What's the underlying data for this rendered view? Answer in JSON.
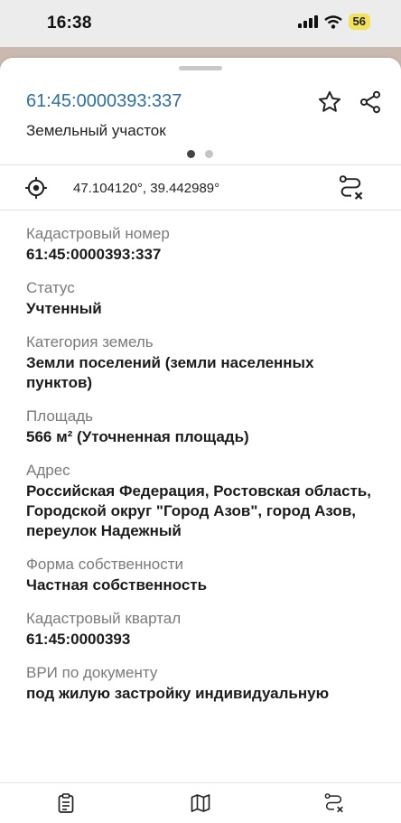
{
  "status_bar": {
    "time": "16:38",
    "battery": "56"
  },
  "card": {
    "cadastral_number": "61:45:0000393:337",
    "object_type": "Земельный участок",
    "coordinates": "47.104120°, 39.442989°",
    "page_dots": {
      "count": 2,
      "active": 0
    }
  },
  "fields": [
    {
      "label": "Кадастровый номер",
      "value": "61:45:0000393:337"
    },
    {
      "label": "Статус",
      "value": "Учтенный"
    },
    {
      "label": "Категория земель",
      "value": "Земли поселений (земли населенных пунктов)"
    },
    {
      "label": "Площадь",
      "value": "566 м² (Уточненная площадь)"
    },
    {
      "label": "Адрес",
      "value": "Российская Федерация, Ростовская область, Городской округ \"Город Азов\", город Азов, переулок Надежный"
    },
    {
      "label": "Форма собственности",
      "value": "Частная собственность"
    },
    {
      "label": "Кадастровый квартал",
      "value": "61:45:0000393"
    },
    {
      "label": "ВРИ по документу",
      "value": "под жилую застройку индивидуальную"
    }
  ],
  "icons": {
    "star": "star-icon",
    "share": "share-icon",
    "locate": "crosshair-icon",
    "route_clear": "route-clear-icon",
    "tab1": "clipboard-icon",
    "tab2": "map-icon",
    "tab3": "route-icon"
  }
}
